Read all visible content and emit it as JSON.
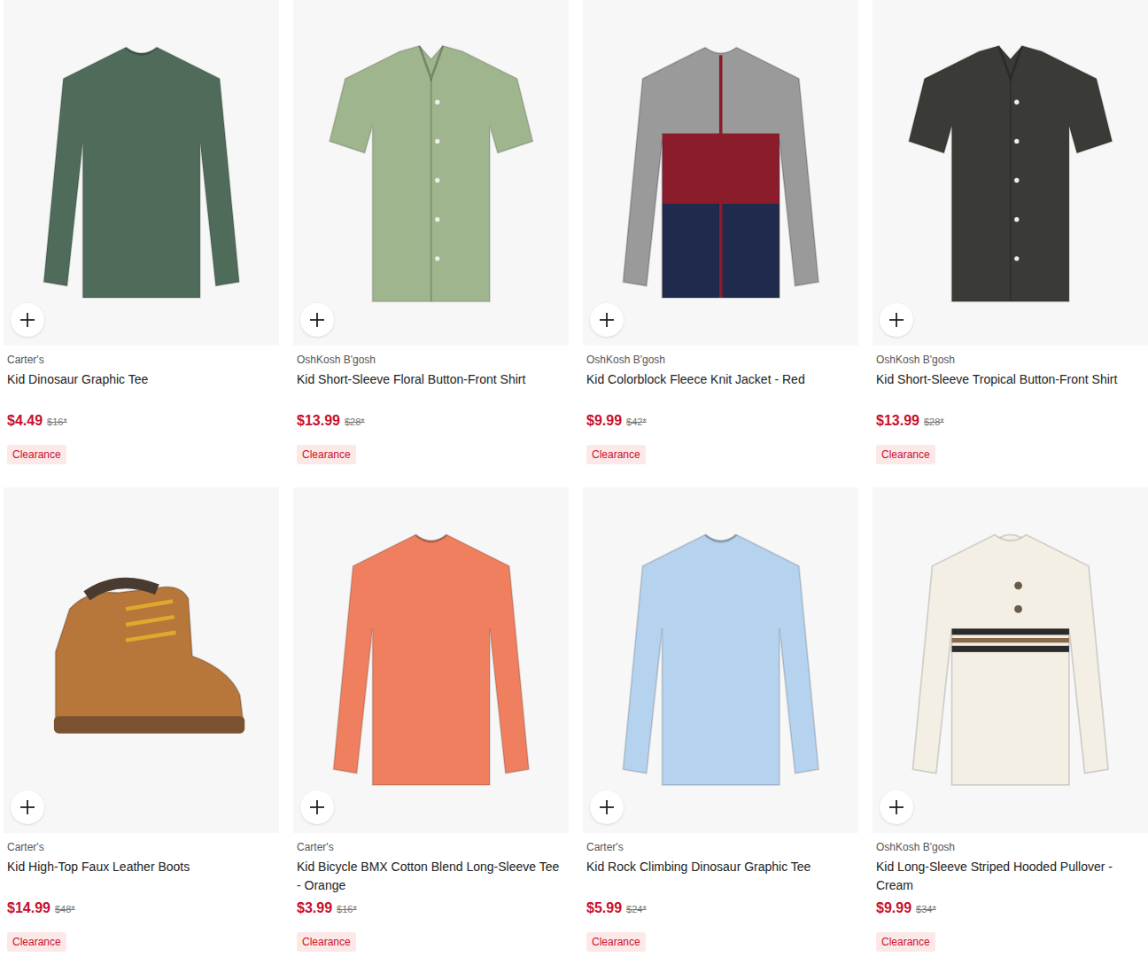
{
  "products": [
    {
      "brand": "Carter's",
      "name": "Kid Dinosaur Graphic Tee",
      "price": "$4.49",
      "original_price": "$16*",
      "badge": "Clearance",
      "kind": "tee",
      "color": "#4f6b5a"
    },
    {
      "brand": "OshKosh B'gosh",
      "name": "Kid Short-Sleeve Floral Button-Front Shirt",
      "price": "$13.99",
      "original_price": "$28*",
      "badge": "Clearance",
      "kind": "shirt",
      "color": "#9fb58d"
    },
    {
      "brand": "OshKosh B'gosh",
      "name": "Kid Colorblock Fleece Knit Jacket - Red",
      "price": "$9.99",
      "original_price": "$42*",
      "badge": "Clearance",
      "kind": "jacket",
      "color": "#8a1c2c"
    },
    {
      "brand": "OshKosh B'gosh",
      "name": "Kid Short-Sleeve Tropical Button-Front Shirt",
      "price": "$13.99",
      "original_price": "$28*",
      "badge": "Clearance",
      "kind": "shirt",
      "color": "#3a3a36"
    },
    {
      "brand": "Carter's",
      "name": "Kid High-Top Faux Leather Boots",
      "price": "$14.99",
      "original_price": "$48*",
      "badge": "Clearance",
      "kind": "boot",
      "color": "#b8773a"
    },
    {
      "brand": "Carter's",
      "name": "Kid Bicycle BMX Cotton Blend Long-Sleeve Tee - Orange",
      "price": "$3.99",
      "original_price": "$16*",
      "badge": "Clearance",
      "kind": "tee",
      "color": "#ef7f5f"
    },
    {
      "brand": "Carter's",
      "name": "Kid Rock Climbing Dinosaur Graphic Tee",
      "price": "$5.99",
      "original_price": "$24*",
      "badge": "Clearance",
      "kind": "tee",
      "color": "#b5d2ee"
    },
    {
      "brand": "OshKosh B'gosh",
      "name": "Kid Long-Sleeve Striped Hooded Pullover - Cream",
      "price": "$9.99",
      "original_price": "$34*",
      "badge": "Clearance",
      "kind": "hoodie",
      "color": "#f3efe4"
    }
  ]
}
